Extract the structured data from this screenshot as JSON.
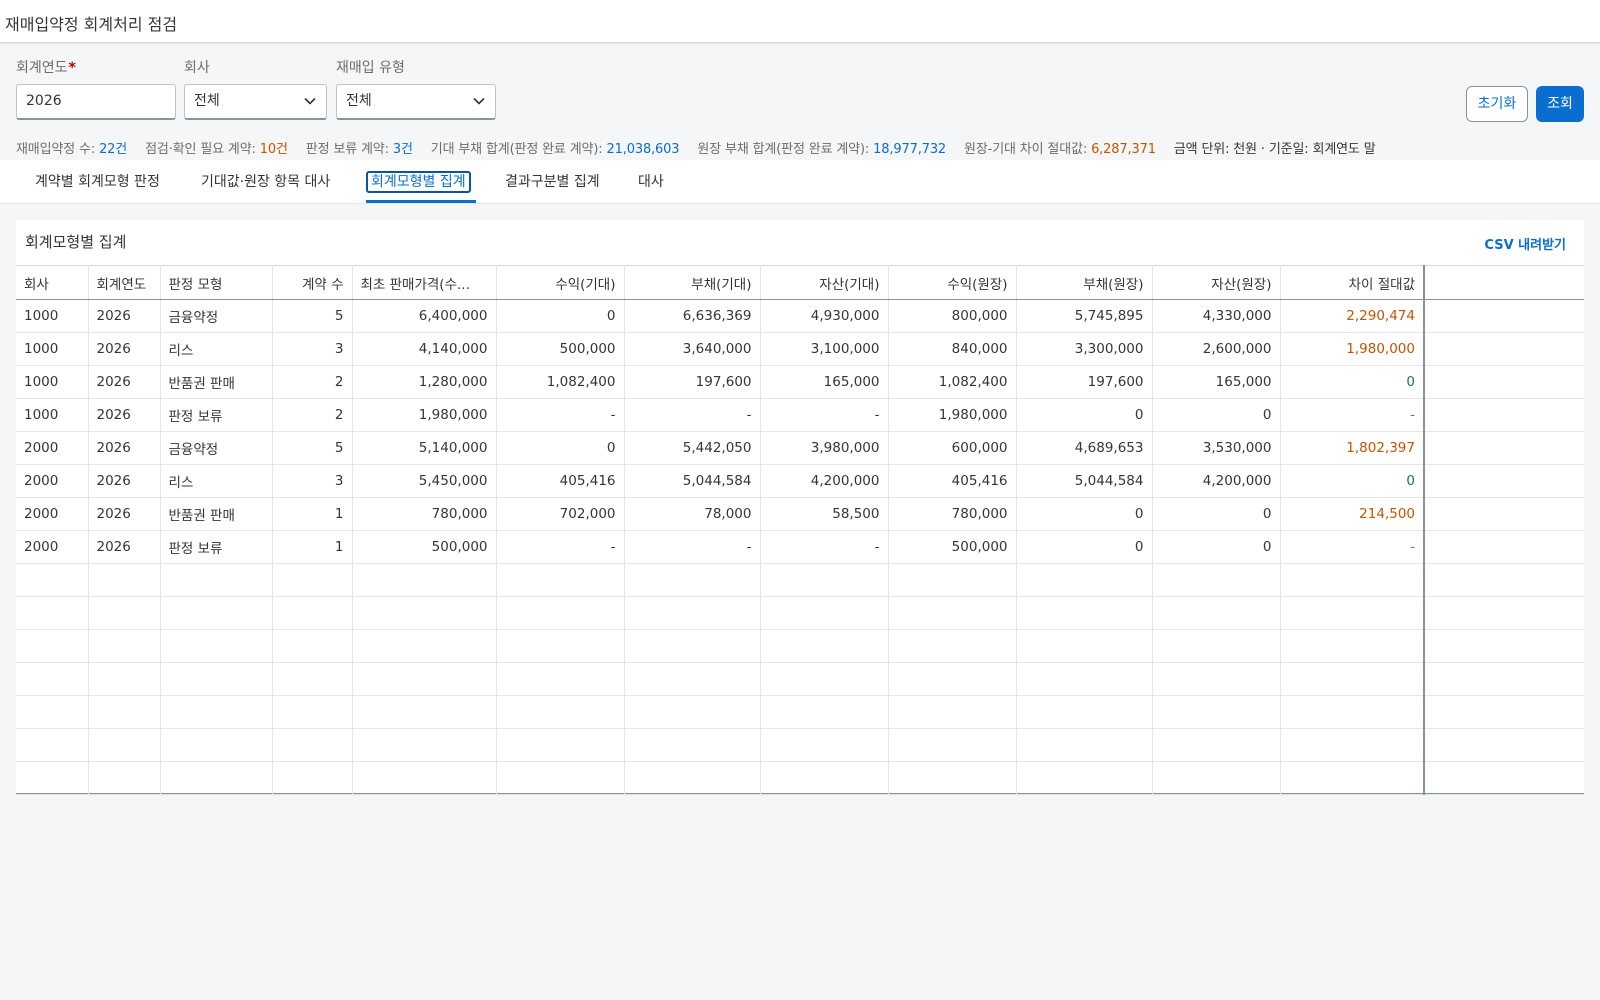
{
  "app": {
    "title": "재매입약정 회계처리 점검"
  },
  "filters": {
    "year": {
      "label": "회계연도",
      "required_mark": "*",
      "value": "2026"
    },
    "company": {
      "label": "회사",
      "value": "전체"
    },
    "type": {
      "label": "재매입 유형",
      "value": "전체"
    }
  },
  "buttons": {
    "reset": "초기화",
    "search": "조회"
  },
  "summary": {
    "contracts": {
      "label": "재매입약정 수: ",
      "value": "22건"
    },
    "check_needed": {
      "label": "점검·확인 필요 계약: ",
      "value": "10건"
    },
    "pending": {
      "label": "판정 보류 계약: ",
      "value": "3건"
    },
    "expected_liability": {
      "label": "기대 부채 합계(판정 완료 계약): ",
      "value": "21,038,603"
    },
    "ledger_liability": {
      "label": "원장 부채 합계(판정 완료 계약): ",
      "value": "18,977,732"
    },
    "abs_diff": {
      "label": "원장-기대 차이 절대값: ",
      "value": "6,287,371"
    },
    "unit_note": "금액 단위: 천원 · 기준일: 회계연도 말"
  },
  "tabs": [
    {
      "label": "계약별 회계모형 판정"
    },
    {
      "label": "기대값·원장 항목 대사"
    },
    {
      "label": "회계모형별 집계"
    },
    {
      "label": "결과구분별 집계"
    },
    {
      "label": "대사"
    }
  ],
  "panel": {
    "title": "회계모형별 집계",
    "csv_label": "CSV 내려받기"
  },
  "table": {
    "columns": [
      "회사",
      "회계연도",
      "판정 모형",
      "계약 수",
      "최초 판매가격(수...",
      "수익(기대)",
      "부채(기대)",
      "자산(기대)",
      "수익(원장)",
      "부채(원장)",
      "자산(원장)",
      "차이 절대값"
    ],
    "rows": [
      {
        "cells": [
          "1000",
          "2026",
          "금융약정",
          "5",
          "6,400,000",
          "0",
          "6,636,369",
          "4,930,000",
          "800,000",
          "5,745,895",
          "4,330,000",
          "2,290,474"
        ],
        "diff_status": "orange"
      },
      {
        "cells": [
          "1000",
          "2026",
          "리스",
          "3",
          "4,140,000",
          "500,000",
          "3,640,000",
          "3,100,000",
          "840,000",
          "3,300,000",
          "2,600,000",
          "1,980,000"
        ],
        "diff_status": "orange"
      },
      {
        "cells": [
          "1000",
          "2026",
          "반품권 판매",
          "2",
          "1,280,000",
          "1,082,400",
          "197,600",
          "165,000",
          "1,082,400",
          "197,600",
          "165,000",
          "0"
        ],
        "diff_status": "green"
      },
      {
        "cells": [
          "1000",
          "2026",
          "판정 보류",
          "2",
          "1,980,000",
          "-",
          "-",
          "-",
          "1,980,000",
          "0",
          "0",
          "-"
        ],
        "diff_status": "gray"
      },
      {
        "cells": [
          "2000",
          "2026",
          "금융약정",
          "5",
          "5,140,000",
          "0",
          "5,442,050",
          "3,980,000",
          "600,000",
          "4,689,653",
          "3,530,000",
          "1,802,397"
        ],
        "diff_status": "orange"
      },
      {
        "cells": [
          "2000",
          "2026",
          "리스",
          "3",
          "5,450,000",
          "405,416",
          "5,044,584",
          "4,200,000",
          "405,416",
          "5,044,584",
          "4,200,000",
          "0"
        ],
        "diff_status": "green"
      },
      {
        "cells": [
          "2000",
          "2026",
          "반품권 판매",
          "1",
          "780,000",
          "702,000",
          "78,000",
          "58,500",
          "780,000",
          "0",
          "0",
          "214,500"
        ],
        "diff_status": "orange"
      },
      {
        "cells": [
          "2000",
          "2026",
          "판정 보류",
          "1",
          "500,000",
          "-",
          "-",
          "-",
          "500,000",
          "0",
          "0",
          "-"
        ],
        "diff_status": "gray"
      }
    ]
  },
  "colors": {
    "accent": "#0a6ed1",
    "warning": "#c35500",
    "positive": "#107e3e"
  },
  "icons": {
    "select_chevron": "chevron-down-icon"
  }
}
